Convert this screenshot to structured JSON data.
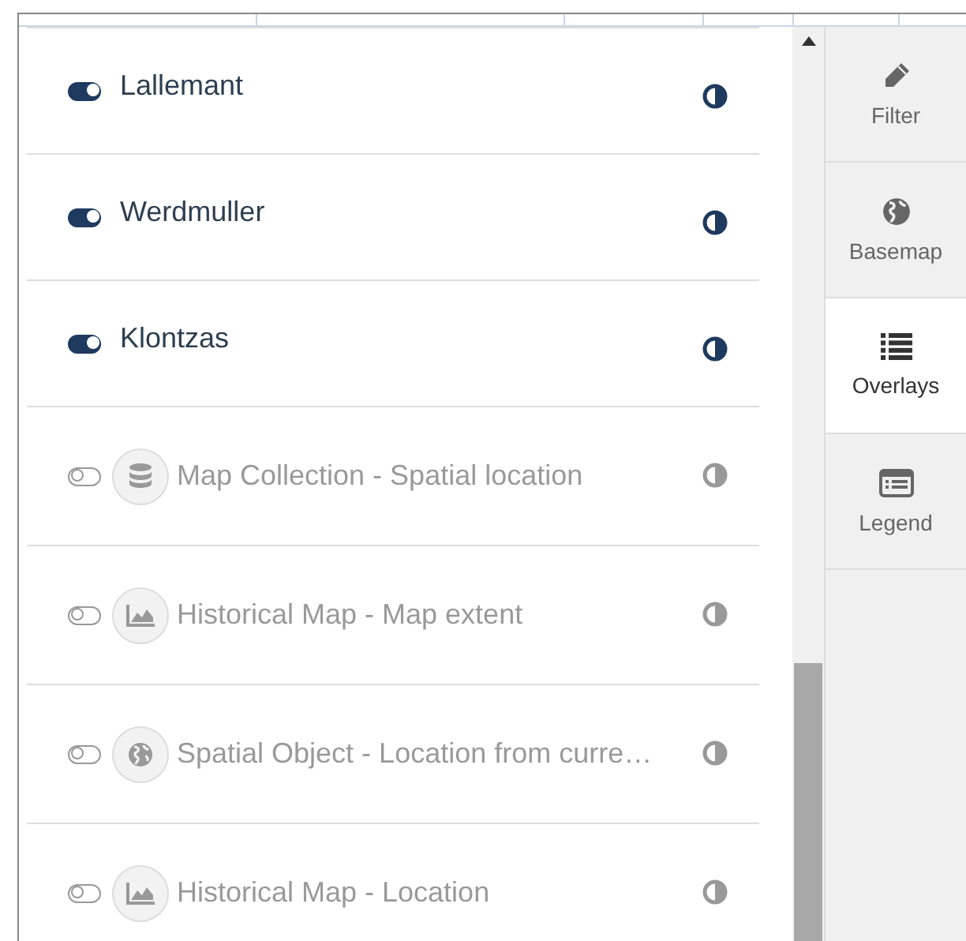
{
  "layers": [
    {
      "name": "Lallemant",
      "on": true,
      "kind": "plain"
    },
    {
      "name": "Werdmuller",
      "on": true,
      "kind": "plain"
    },
    {
      "name": "Klontzas",
      "on": true,
      "kind": "plain"
    },
    {
      "name": "Map Collection - Spatial location",
      "on": false,
      "kind": "database"
    },
    {
      "name": "Historical Map - Map extent",
      "on": false,
      "kind": "mountain"
    },
    {
      "name": "Spatial Object - Location from curre…",
      "on": false,
      "kind": "globe"
    },
    {
      "name": "Historical Map - Location",
      "on": false,
      "kind": "mountain"
    }
  ],
  "tabs": [
    {
      "label": "Filter",
      "kind": "pencil",
      "selected": false
    },
    {
      "label": "Basemap",
      "kind": "globe",
      "selected": false
    },
    {
      "label": "Overlays",
      "kind": "list",
      "selected": true
    },
    {
      "label": "Legend",
      "kind": "legend",
      "selected": false
    }
  ]
}
